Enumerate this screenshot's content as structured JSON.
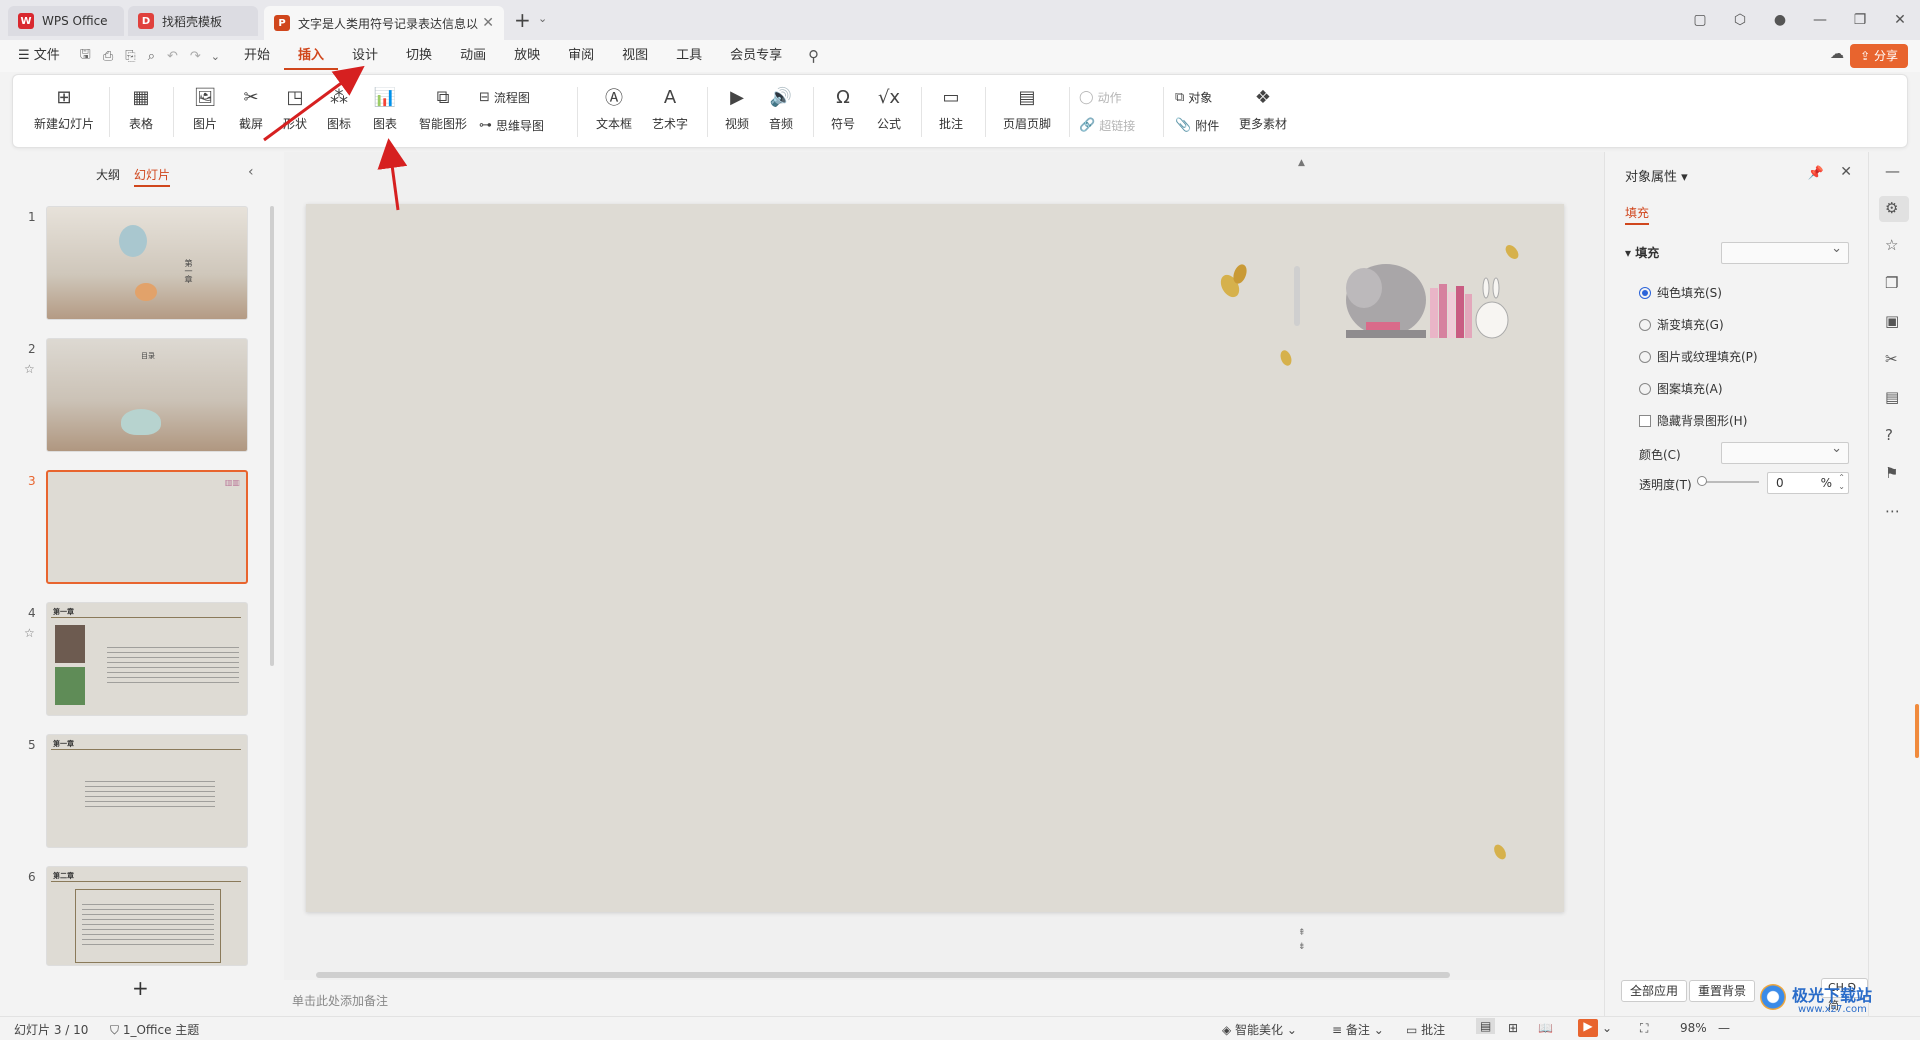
{
  "titlebar": {
    "tabs": [
      {
        "label": "WPS Office",
        "icon": "wps-logo-icon"
      },
      {
        "label": "找稻壳模板",
        "icon": "docer-icon"
      },
      {
        "label": "文字是人类用符号记录表达信息以",
        "icon": "ppt-icon"
      }
    ],
    "new_tab": "+"
  },
  "menubar": {
    "file": "☰ 文件",
    "items": [
      "开始",
      "插入",
      "设计",
      "切换",
      "动画",
      "放映",
      "审阅",
      "视图",
      "工具",
      "会员专享"
    ],
    "active": "插入",
    "share": "分享"
  },
  "ribbon": {
    "new_slide": "新建幻灯片",
    "table": "表格",
    "picture": "图片",
    "screenshot": "截屏",
    "shape": "形状",
    "icon": "图标",
    "chart": "图表",
    "smart_art": "智能图形",
    "flowchart": "流程图",
    "mindmap": "思维导图",
    "textbox": "文本框",
    "wordart": "艺术字",
    "video": "视频",
    "audio": "音频",
    "symbol": "符号",
    "formula": "公式",
    "comment": "批注",
    "header_footer": "页眉页脚",
    "action": "动作",
    "hyperlink": "超链接",
    "object": "对象",
    "attachment": "附件",
    "more_material": "更多素材"
  },
  "leftpanel": {
    "tabs": [
      "大纲",
      "幻灯片"
    ],
    "active_tab": "幻灯片",
    "slides": [
      {
        "num": "1",
        "title": "第一章"
      },
      {
        "num": "2",
        "title": "目录"
      },
      {
        "num": "3",
        "title": ""
      },
      {
        "num": "4",
        "title": "第一章"
      },
      {
        "num": "5",
        "title": "第一章"
      },
      {
        "num": "6",
        "title": "第二章"
      }
    ],
    "add": "+"
  },
  "notes_placeholder": "单击此处添加备注",
  "rightpanel": {
    "title": "对象属性",
    "tab": "填充",
    "fill_label": "填充",
    "options": [
      "纯色填充(S)",
      "渐变填充(G)",
      "图片或纹理填充(P)",
      "图案填充(A)"
    ],
    "selected_option": "纯色填充(S)",
    "hide_bg": "隐藏背景图形(H)",
    "color_label": "颜色(C)",
    "transparency_label": "透明度(T)",
    "transparency_value": "0",
    "transparency_unit": "%",
    "apply_all": "全部应用",
    "reset_bg": "重置背景",
    "ime": "CH ⅁ 简"
  },
  "statusbar": {
    "slide_info": "幻灯片 3 / 10",
    "theme": "1_Office 主题",
    "beautify": "智能美化",
    "notes": "备注",
    "comment": "批注",
    "zoom": "98%"
  },
  "watermark": "极光下载站",
  "watermark_url": "www.xz7.com",
  "colors": {
    "accent": "#d0461c",
    "share": "#e8642e",
    "slide_bg": "#dedbd4"
  }
}
